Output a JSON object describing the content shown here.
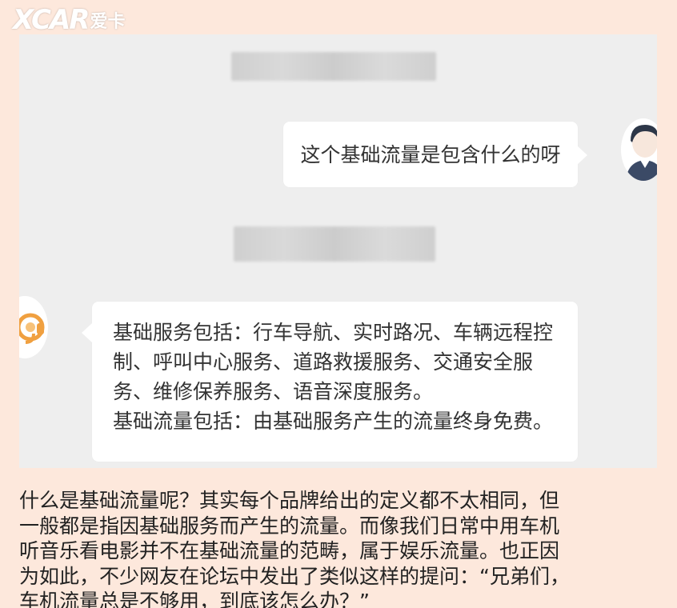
{
  "watermark": {
    "mark": "XCAR",
    "cn": "爱卡"
  },
  "chat": {
    "user_message": "这个基础流量是包含什么的呀",
    "agent_message_lines": [
      "基础服务包括：行车导航、实时路况、车辆远程控",
      "制、呼叫中心服务、道路救援服务、交通安全服",
      "务、维修保养服务、语音深度服务。",
      "基础流量包括：由基础服务产生的流量终身免费。"
    ]
  },
  "article": {
    "lines": [
      "什么是基础流量呢？其实每个品牌给出的定义都不太相同，但",
      "一般都是指因基础服务而产生的流量。而像我们日常中用车机",
      "听音乐看电影并不在基础流量的范畴，属于娱乐流量。也正因",
      "为如此，不少网友在论坛中发出了类似这样的提问：“兄弟们，",
      "车机流量总是不够用，到底该怎么办？”"
    ]
  },
  "colors": {
    "page_background": "#fde8dc",
    "chat_background": "#eeeeee",
    "bubble": "#ffffff",
    "agent_icon_accent": "#f0a040"
  },
  "icons": {
    "watermark": "xcar-logo",
    "user_avatar": "user-avatar-icon",
    "agent_avatar": "headset-agent-icon"
  }
}
